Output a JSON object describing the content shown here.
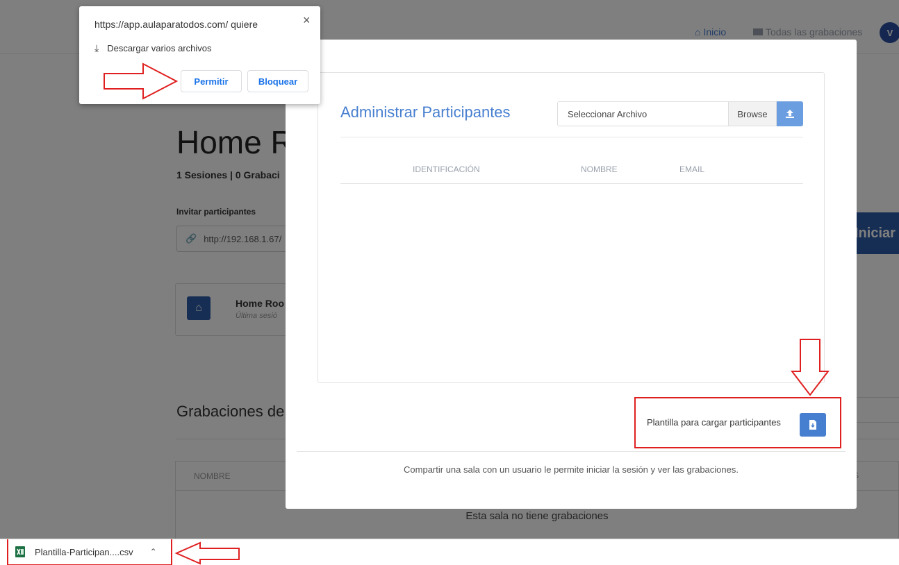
{
  "nav": {
    "inicio": "Inicio",
    "todas": "Todas las grabaciones",
    "avatar_initial": "V"
  },
  "room": {
    "title": "Home R",
    "subtitle": "1 Sesiones | 0 Grabaci",
    "invite_label": "Invitar participantes",
    "invite_url": "http://192.168.1.67/",
    "start_label": "Iniciar",
    "card_name": "Home Roo",
    "card_last": "Última sesió"
  },
  "recordings": {
    "title": "Grabaciones de",
    "column_name": "NOMBRE",
    "column_right": "S",
    "empty": "Esta sala no tiene grabaciones"
  },
  "modal": {
    "title": "Administrar Participantes",
    "file_placeholder": "Seleccionar Archivo",
    "browse_label": "Browse",
    "columns": [
      "IDENTIFICACIÓN",
      "NOMBRE",
      "EMAIL"
    ],
    "template_label": "Plantilla para cargar participantes",
    "footer": "Compartir una sala con un usuario le permite iniciar la sesión y ver las grabaciones."
  },
  "popup": {
    "site": "https://app.aulaparatodos.com/ quiere",
    "permission": "Descargar varios archivos",
    "allow": "Permitir",
    "block": "Bloquear",
    "close": "×"
  },
  "download": {
    "filename": "Plantilla-Participan....csv",
    "file_icon": "excel-file-icon"
  },
  "colors": {
    "accent": "#467fcf",
    "annotation": "#e02020",
    "primary_dark": "#2e5da8"
  }
}
